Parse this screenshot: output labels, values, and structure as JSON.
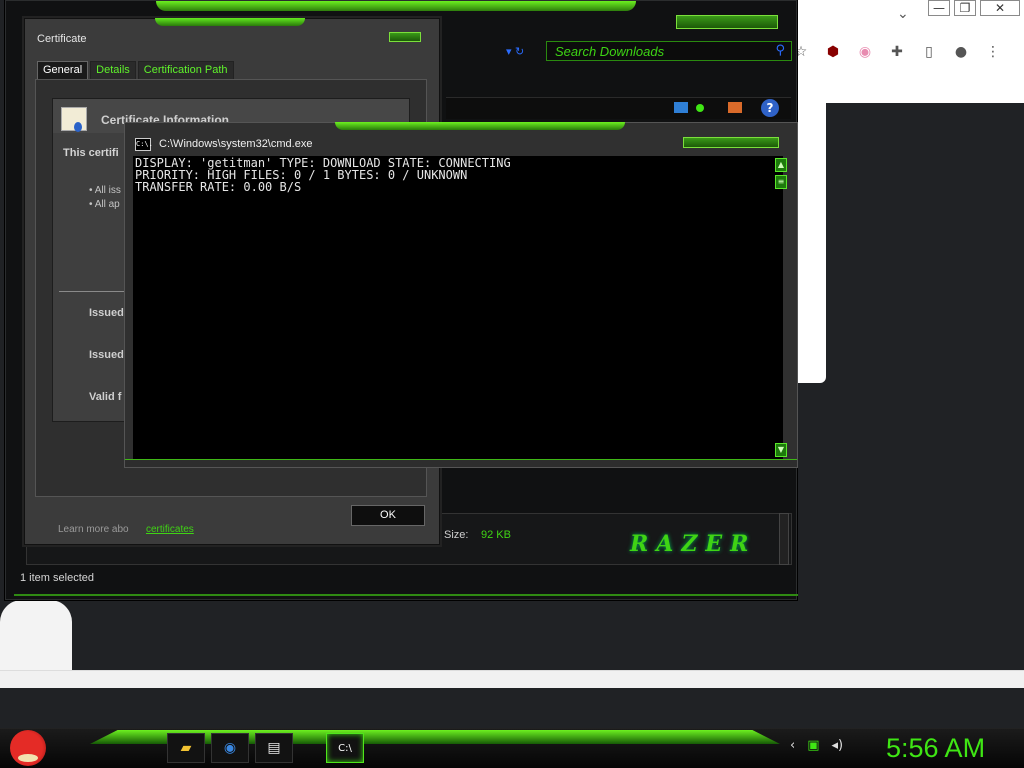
{
  "chrome": {
    "minimize": "—",
    "restore": "❐",
    "close": "✕",
    "chevron": "⌄",
    "icons": [
      "star-icon",
      "ublock-icon",
      "flag-icon",
      "extensions-icon",
      "sidepanel-icon",
      "profile-icon",
      "menu-icon"
    ]
  },
  "explorer": {
    "search_placeholder": "Search Downloads",
    "status": "1 item selected",
    "size_label": "Size:",
    "size_value": "92 KB",
    "brand": "RAZER"
  },
  "certificate": {
    "title": "Certificate",
    "tabs": [
      "General",
      "Details",
      "Certification Path"
    ],
    "info_title": "Certificate Information",
    "purpose_text": "This certifi",
    "bullets": [
      "• All iss",
      "• All ap"
    ],
    "fields": [
      "Issued",
      "Issued",
      "Valid f"
    ],
    "learn_more": "Learn more abo",
    "learn_more_link": "certificates",
    "ok": "OK"
  },
  "cmd": {
    "title": "C:\\Windows\\system32\\cmd.exe",
    "icon_text": "C:\\.",
    "lines": [
      "DISPLAY: 'getitman' TYPE: DOWNLOAD STATE: CONNECTING",
      "PRIORITY: HIGH FILES: 0 / 1 BYTES: 0 / UNKNOWN",
      "TRANSFER RATE: 0.00 B/S"
    ]
  },
  "taskbar": {
    "apps": [
      "file-explorer",
      "chrome",
      "notepad",
      "cmd"
    ],
    "clock": "5:56 AM"
  },
  "colors": {
    "accent": "#3fe614",
    "chrome_bg": "#ffffff",
    "desk_bg": "#202225"
  }
}
